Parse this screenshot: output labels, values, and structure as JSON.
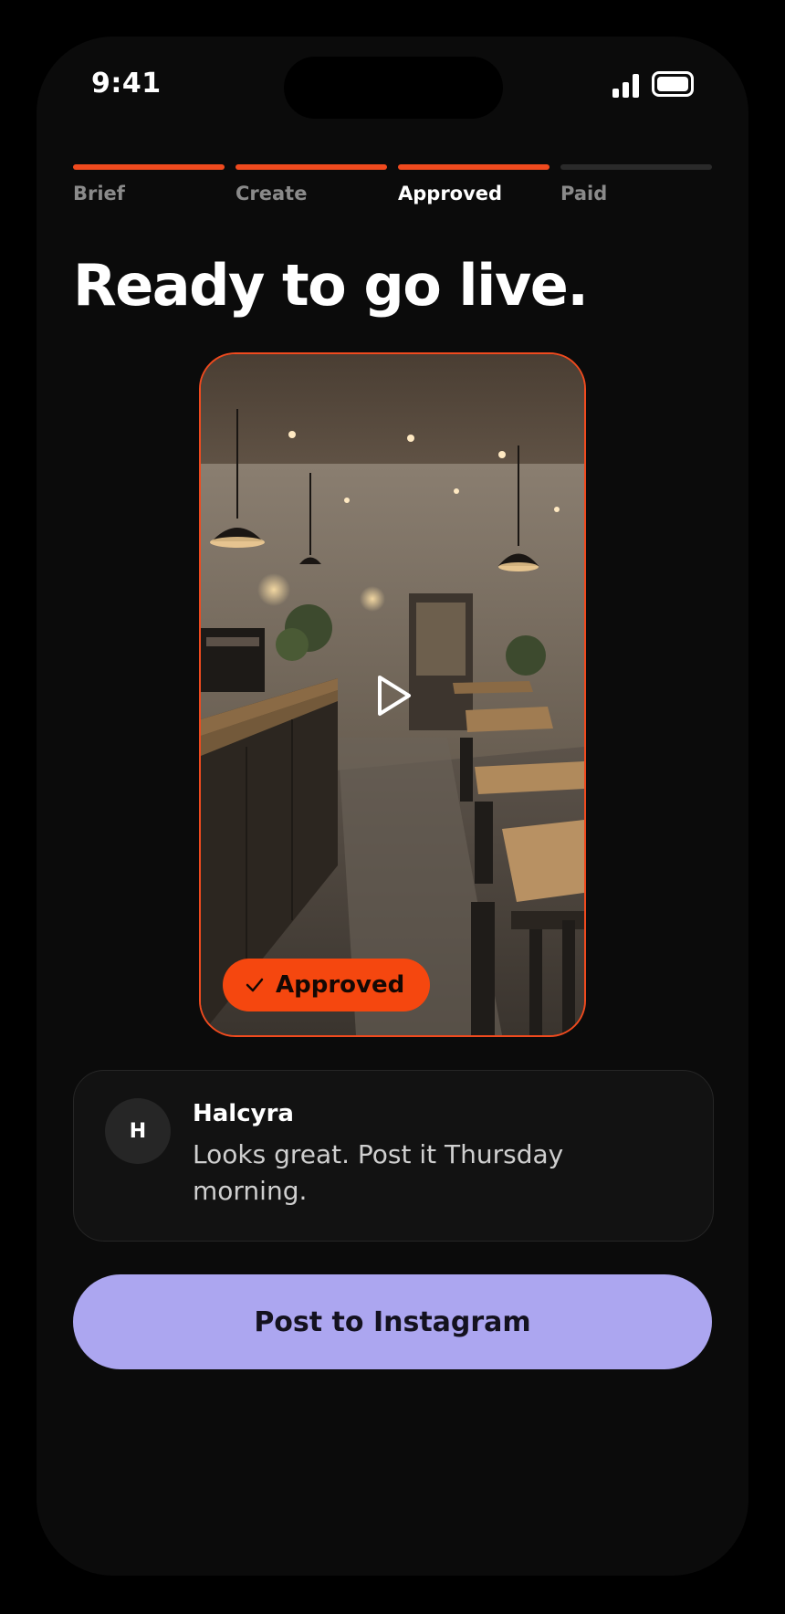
{
  "status_bar": {
    "time": "9:41"
  },
  "steps": [
    {
      "label": "Brief",
      "state": "done"
    },
    {
      "label": "Create",
      "state": "done"
    },
    {
      "label": "Approved",
      "state": "current"
    },
    {
      "label": "Paid",
      "state": "upcoming"
    }
  ],
  "page_title": "Ready to go live.",
  "video": {
    "badge_label": "Approved",
    "play_icon": "play-icon",
    "check_icon": "check-icon"
  },
  "comment": {
    "avatar_initial": "H",
    "author": "Halcyra",
    "text": "Looks great. Post it Thursday morning."
  },
  "cta": {
    "label": "Post to Instagram"
  },
  "colors": {
    "accent": "#f04a1e",
    "cta_background": "#aca6f0",
    "screen_background": "#0b0b0b"
  }
}
